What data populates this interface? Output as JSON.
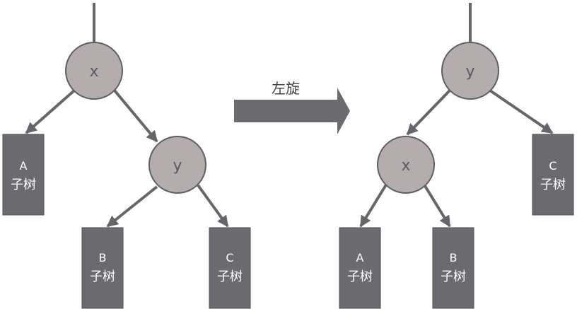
{
  "before": {
    "root": "x",
    "right_child": "y",
    "subtrees": [
      {
        "letter": "A",
        "word": "子树"
      },
      {
        "letter": "B",
        "word": "子树"
      },
      {
        "letter": "C",
        "word": "子树"
      }
    ]
  },
  "operation": {
    "label": "左旋"
  },
  "after": {
    "root": "y",
    "left_child": "x",
    "subtrees": [
      {
        "letter": "A",
        "word": "子树"
      },
      {
        "letter": "B",
        "word": "子树"
      },
      {
        "letter": "C",
        "word": "子树"
      }
    ]
  },
  "colors": {
    "node_fill": "#b5adad",
    "node_stroke": "#5f5f63",
    "subtree_fill": "#6b6a6e",
    "edge": "#66656a"
  }
}
